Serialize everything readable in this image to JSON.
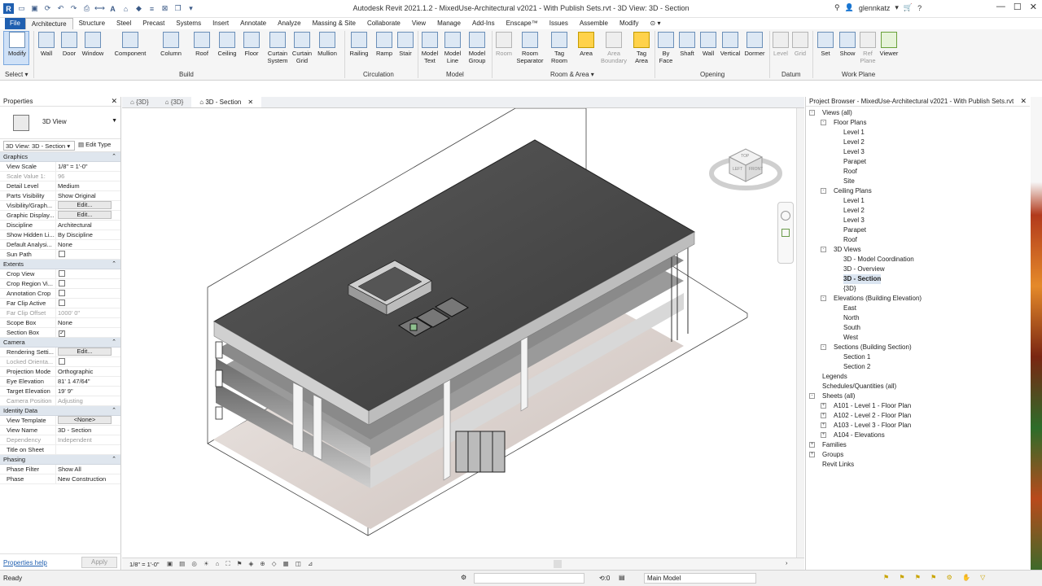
{
  "title_bar": {
    "title": "Autodesk Revit 2021.1.2 - MixedUse-Architectural v2021 - With Publish Sets.rvt - 3D View: 3D - Section",
    "user": "glennkatz"
  },
  "tabs": [
    "File",
    "Architecture",
    "Structure",
    "Steel",
    "Precast",
    "Systems",
    "Insert",
    "Annotate",
    "Analyze",
    "Massing & Site",
    "Collaborate",
    "View",
    "Manage",
    "Add-Ins",
    "Enscape™",
    "Issues",
    "Assemble",
    "Modify"
  ],
  "ribbon": {
    "modify": "Modify",
    "select": "Select",
    "build_buttons": [
      "Wall",
      "Door",
      "Window",
      "Component",
      "Column",
      "Roof",
      "Ceiling",
      "Floor",
      "Curtain System",
      "Curtain Grid",
      "Mullion"
    ],
    "circulation_buttons": [
      "Railing",
      "Ramp",
      "Stair"
    ],
    "model_buttons": [
      "Model Text",
      "Model Line",
      "Model Group"
    ],
    "room_buttons": [
      "Room",
      "Room Separator",
      "Tag Room",
      "Area",
      "Area Boundary",
      "Tag Area"
    ],
    "opening_buttons": [
      "By Face",
      "Shaft",
      "Wall",
      "Vertical",
      "Dormer"
    ],
    "datum_buttons": [
      "Level",
      "Grid"
    ],
    "workplane_buttons": [
      "Set",
      "Show",
      "Ref Plane",
      "Viewer"
    ],
    "panels": [
      "Build",
      "Circulation",
      "Model",
      "Room & Area",
      "Opening",
      "Datum",
      "Work Plane"
    ]
  },
  "properties": {
    "header": "Properties",
    "type_name": "3D View",
    "selector": "3D View: 3D - Section",
    "edit_type": "Edit Type",
    "help": "Properties help",
    "apply": "Apply",
    "sections": [
      {
        "name": "Graphics",
        "rows": [
          {
            "k": "View Scale",
            "v": "1/8\" = 1'-0\""
          },
          {
            "k": "Scale Value    1:",
            "v": "96",
            "dis": true
          },
          {
            "k": "Detail Level",
            "v": "Medium"
          },
          {
            "k": "Parts Visibility",
            "v": "Show Original"
          },
          {
            "k": "Visibility/Graph...",
            "v": "Edit...",
            "btn": true
          },
          {
            "k": "Graphic Display...",
            "v": "Edit...",
            "btn": true
          },
          {
            "k": "Discipline",
            "v": "Architectural"
          },
          {
            "k": "Show Hidden Li...",
            "v": "By Discipline"
          },
          {
            "k": "Default Analysi...",
            "v": "None"
          },
          {
            "k": "Sun Path",
            "v": "",
            "cb": "off"
          }
        ]
      },
      {
        "name": "Extents",
        "rows": [
          {
            "k": "Crop View",
            "v": "",
            "cb": "off"
          },
          {
            "k": "Crop Region Vi...",
            "v": "",
            "cb": "off"
          },
          {
            "k": "Annotation Crop",
            "v": "",
            "cb": "off"
          },
          {
            "k": "Far Clip Active",
            "v": "",
            "cb": "off"
          },
          {
            "k": "Far Clip Offset",
            "v": "1000' 0\"",
            "dis": true
          },
          {
            "k": "Scope Box",
            "v": "None"
          },
          {
            "k": "Section Box",
            "v": "",
            "cb": "on"
          }
        ]
      },
      {
        "name": "Camera",
        "rows": [
          {
            "k": "Rendering Setti...",
            "v": "Edit...",
            "btn": true
          },
          {
            "k": "Locked Orienta...",
            "v": "",
            "cb": "off",
            "dis": true
          },
          {
            "k": "Projection Mode",
            "v": "Orthographic"
          },
          {
            "k": "Eye Elevation",
            "v": "81' 1 47/64\""
          },
          {
            "k": "Target Elevation",
            "v": "19' 9\""
          },
          {
            "k": "Camera Position",
            "v": "Adjusting",
            "dis": true
          }
        ]
      },
      {
        "name": "Identity Data",
        "rows": [
          {
            "k": "View Template",
            "v": "<None>",
            "btn": true
          },
          {
            "k": "View Name",
            "v": "3D - Section"
          },
          {
            "k": "Dependency",
            "v": "Independent",
            "dis": true
          },
          {
            "k": "Title on Sheet",
            "v": ""
          }
        ]
      },
      {
        "name": "Phasing",
        "rows": [
          {
            "k": "Phase Filter",
            "v": "Show All"
          },
          {
            "k": "Phase",
            "v": "New Construction"
          }
        ]
      }
    ]
  },
  "view_tabs": [
    {
      "label": "{3D}",
      "active": false
    },
    {
      "label": "{3D}",
      "active": false
    },
    {
      "label": "3D - Section",
      "active": true
    }
  ],
  "view_bar": {
    "scale": "1/8\" = 1'-0\""
  },
  "project_browser": {
    "header": "Project Browser - MixedUse-Architectural v2021 - With Publish Sets.rvt",
    "items": [
      {
        "t": "Views (all)",
        "lvl": 0,
        "tog": "-"
      },
      {
        "t": "Floor Plans",
        "lvl": 1,
        "tog": "-"
      },
      {
        "t": "Level 1",
        "lvl": 2
      },
      {
        "t": "Level 2",
        "lvl": 2
      },
      {
        "t": "Level 3",
        "lvl": 2
      },
      {
        "t": "Parapet",
        "lvl": 2
      },
      {
        "t": "Roof",
        "lvl": 2
      },
      {
        "t": "Site",
        "lvl": 2
      },
      {
        "t": "Ceiling Plans",
        "lvl": 1,
        "tog": "-"
      },
      {
        "t": "Level 1",
        "lvl": 2
      },
      {
        "t": "Level 2",
        "lvl": 2
      },
      {
        "t": "Level 3",
        "lvl": 2
      },
      {
        "t": "Parapet",
        "lvl": 2
      },
      {
        "t": "Roof",
        "lvl": 2
      },
      {
        "t": "3D Views",
        "lvl": 1,
        "tog": "-"
      },
      {
        "t": "3D - Model Coordination",
        "lvl": 2
      },
      {
        "t": "3D - Overview",
        "lvl": 2
      },
      {
        "t": "3D - Section",
        "lvl": 2,
        "sel": true
      },
      {
        "t": "{3D}",
        "lvl": 2
      },
      {
        "t": "Elevations (Building Elevation)",
        "lvl": 1,
        "tog": "-"
      },
      {
        "t": "East",
        "lvl": 2
      },
      {
        "t": "North",
        "lvl": 2
      },
      {
        "t": "South",
        "lvl": 2
      },
      {
        "t": "West",
        "lvl": 2
      },
      {
        "t": "Sections (Building Section)",
        "lvl": 1,
        "tog": "-"
      },
      {
        "t": "Section 1",
        "lvl": 2
      },
      {
        "t": "Section 2",
        "lvl": 2
      },
      {
        "t": "Legends",
        "lvl": 0
      },
      {
        "t": "Schedules/Quantities (all)",
        "lvl": 0
      },
      {
        "t": "Sheets (all)",
        "lvl": 0,
        "tog": "-"
      },
      {
        "t": "A101 - Level 1 - Floor Plan",
        "lvl": 1,
        "tog": "+"
      },
      {
        "t": "A102 - Level 2 - Floor Plan",
        "lvl": 1,
        "tog": "+"
      },
      {
        "t": "A103 - Level 3 - Floor Plan",
        "lvl": 1,
        "tog": "+"
      },
      {
        "t": "A104 - Elevations",
        "lvl": 1,
        "tog": "+"
      },
      {
        "t": "Families",
        "lvl": 0,
        "tog": "+"
      },
      {
        "t": "Groups",
        "lvl": 0,
        "tog": "+"
      },
      {
        "t": "Revit Links",
        "lvl": 0
      }
    ]
  },
  "status": {
    "text": "Ready",
    "zero": ":0",
    "model": "Main Model"
  },
  "viewcube": {
    "top": "TOP",
    "left": "LEFT",
    "front": "FRONT"
  }
}
